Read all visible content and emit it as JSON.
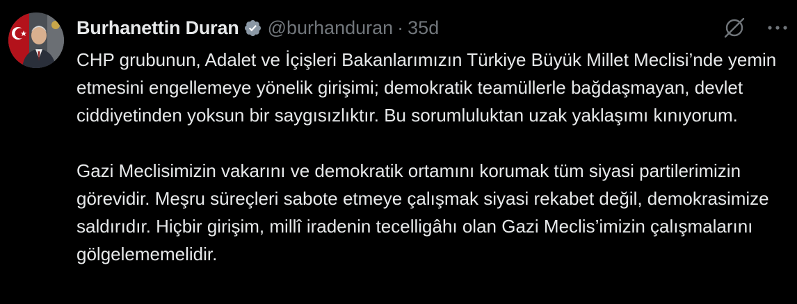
{
  "author": {
    "name": "Burhanettin Duran",
    "handle": "@burhanduran",
    "separator": "·",
    "time": "35d",
    "verified_color": "#8b98a5"
  },
  "icons": {
    "avatar": "profile-photo",
    "verified": "verified-badge-icon",
    "grok": "grok-icon",
    "more": "more-options-icon"
  },
  "tweet": {
    "paragraphs": [
      "CHP grubunun, Adalet ve İçişleri Bakanlarımızın Türkiye Büyük Millet Meclisi’nde yemin etmesini engellemeye yönelik girişimi; demokratik teamüllerle bağdaşmayan, devlet ciddiyetinden yoksun bir saygısızlıktır. Bu sorumluluktan uzak yaklaşımı kınıyorum.",
      "Gazi Meclisimizin vakarını ve demokratik ortamını korumak tüm siyasi partilerimizin görevidir. Meşru süreçleri sabote etmeye çalışmak siyasi rekabet değil, demokrasimize saldırıdır. Hiçbir girişim, millî iradenin tecelligâhı olan Gazi Meclis’imizin çalışmalarını gölgelememelidir."
    ]
  },
  "colors": {
    "background": "#000000",
    "text": "#e7e9ea",
    "muted": "#71767b"
  }
}
